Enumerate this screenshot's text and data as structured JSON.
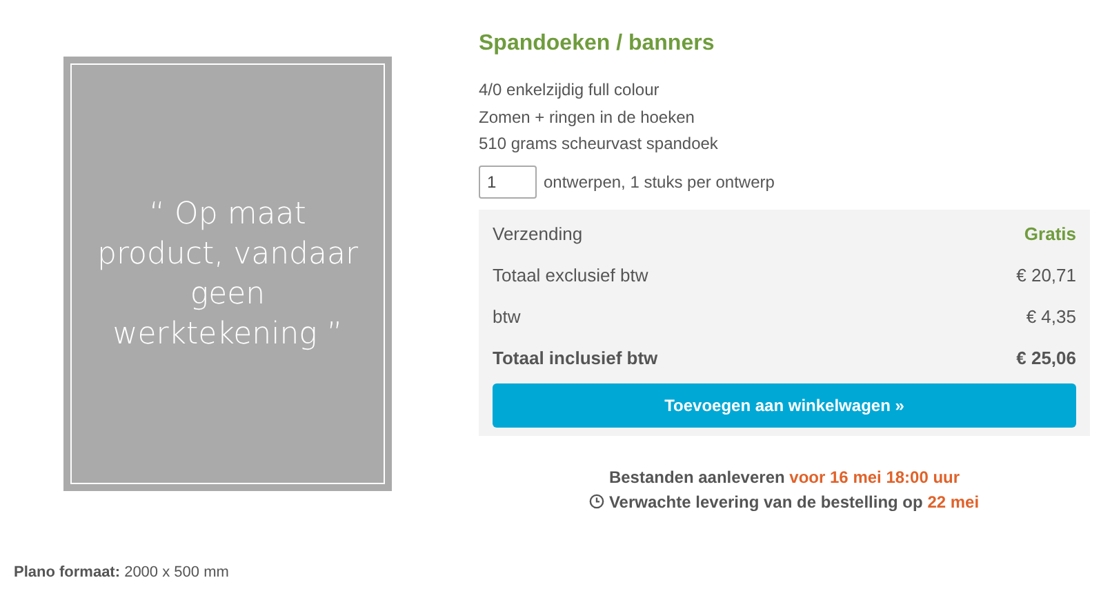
{
  "placeholder_image": {
    "text": "“ Op maat product, vandaar geen werktekening ”"
  },
  "product": {
    "title": "Spandoeken / banners",
    "specs": [
      "4/0 enkelzijdig full colour",
      "Zomen + ringen in de hoeken",
      "510 grams scheurvast spandoek"
    ],
    "quantity": {
      "value": "1",
      "label": "ontwerpen, 1 stuks per ontwerp"
    }
  },
  "summary": {
    "rows": [
      {
        "kind": "free",
        "label": "Verzending",
        "value": "Gratis"
      },
      {
        "kind": "normal",
        "label": "Totaal exclusief btw",
        "value": "€ 20,71"
      },
      {
        "kind": "normal",
        "label": "btw",
        "value": "€ 4,35"
      },
      {
        "kind": "total",
        "label": "Totaal inclusief btw",
        "value": "€ 25,06"
      }
    ],
    "button": "Toevoegen aan winkelwagen »"
  },
  "delivery": [
    {
      "kind": "deadline",
      "text": "Bestanden aanleveren ",
      "highlight": "voor 16 mei 18:00 uur"
    },
    {
      "kind": "clock",
      "text": "Verwachte levering van de bestelling op ",
      "highlight": "22 mei"
    }
  ],
  "format": "**Plano formaat:** 2000 x 500 mm"
}
